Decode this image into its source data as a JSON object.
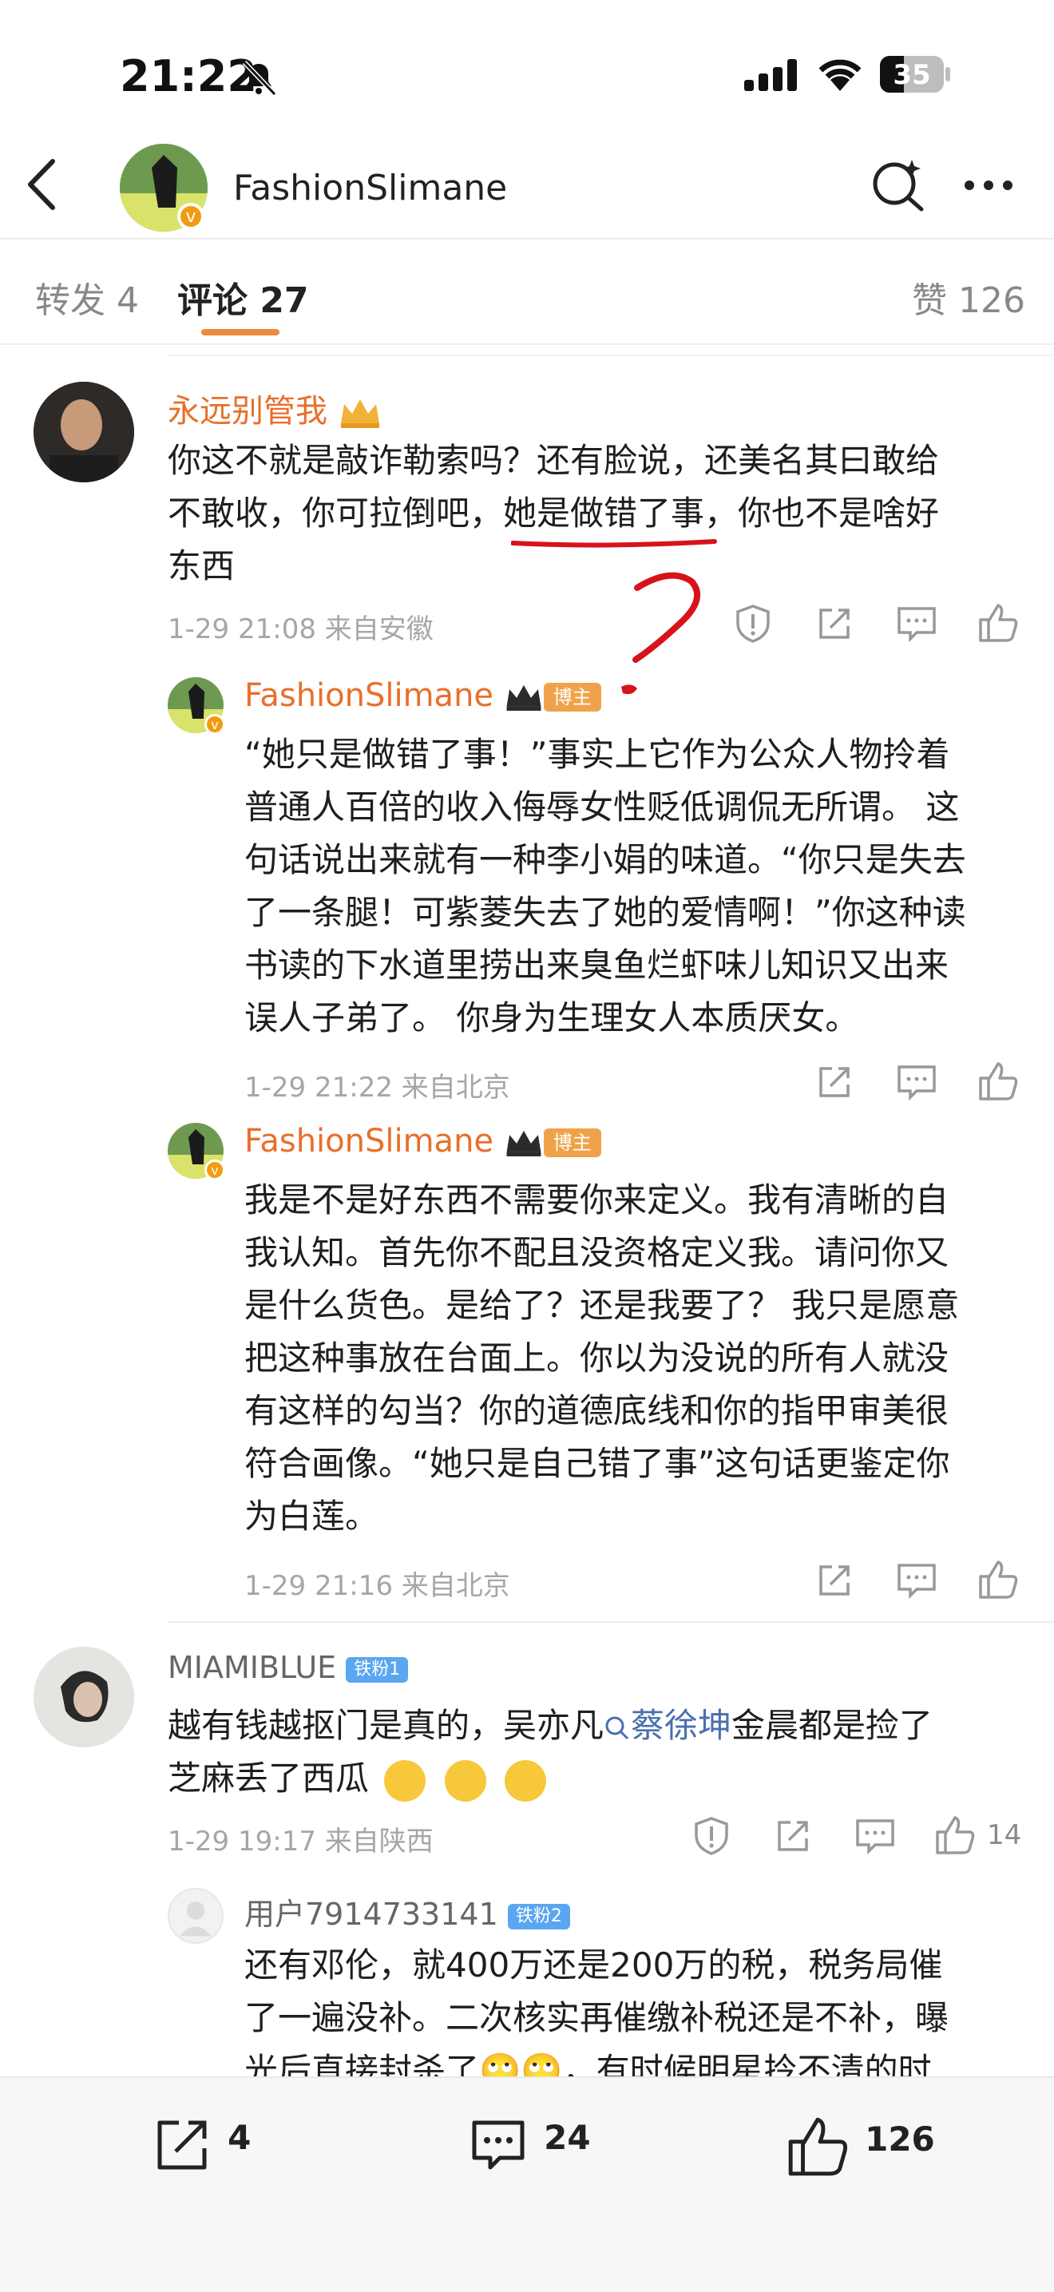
{
  "status_bar": {
    "time": "21:22",
    "battery": "35"
  },
  "nav": {
    "title": "FashionSlimane"
  },
  "tabs": {
    "repost": "转发 4",
    "comments": "评论 27",
    "likes": "赞 126"
  },
  "comments": [
    {
      "user": "永远别管我",
      "text": [
        "你这不就是敲诈勒索吗？还有脸说，还美名其曰敢给",
        "不敢收，你可拉倒吧，她是做错了事，你也不是啥好",
        "东西"
      ],
      "meta": "1-29 21:08  来自安徽",
      "replies": [
        {
          "user": "FashionSlimane",
          "badge": "博主",
          "text": [
            "“她只是做错了事！”事实上它作为公众人物拎着",
            "普通人百倍的收入侮辱女性贬低调侃无所谓。 这",
            "句话说出来就有一种李小娟的味道。“你只是失去",
            "了一条腿！可紫菱失去了她的爱情啊！”你这种读",
            "书读的下水道里捞出来臭鱼烂虾味儿知识又出来",
            "误人子弟了。 你身为生理女人本质厌女。"
          ],
          "meta": "1-29 21:22  来自北京"
        },
        {
          "user": "FashionSlimane",
          "badge": "博主",
          "text": [
            "我是不是好东西不需要你来定义。我有清晰的自",
            "我认知。首先你不配且没资格定义我。请问你又",
            "是什么货色。是给了？还是我要了？ 我只是愿意",
            "把这种事放在台面上。你以为没说的所有人就没",
            "有这样的勾当？你的道德底线和你的指甲审美很",
            "符合画像。“她只是自己错了事”这句话更鉴定你",
            "为白莲。"
          ],
          "meta": "1-29 21:16  来自北京"
        }
      ]
    },
    {
      "user": "MIAMIBLUE",
      "fan_badge": "铁粉1",
      "text_a": "越有钱越抠门是真的，吴亦凡",
      "link": "蔡徐坤",
      "text_b": "金晨都是捡了",
      "text_2": "芝麻丢了西瓜",
      "meta": "1-29 19:17  来自陕西",
      "likes": "14",
      "replies": [
        {
          "user": "用户7914733141",
          "fan_badge": "铁粉2",
          "text": [
            "还有邓伦，就400万还是200万的税，税务局催",
            "了一遍没补。二次核实再催缴补税还是不补，曝",
            "光后直接封杀了🙄🙄，有时候明星拎不清的时"
          ]
        }
      ]
    }
  ],
  "bottom": {
    "reposts": "4",
    "comments": "24",
    "likes": "126"
  },
  "colors": {
    "accent": "#e86f2b",
    "link": "#4a6fae",
    "annotation": "#d8121b"
  }
}
